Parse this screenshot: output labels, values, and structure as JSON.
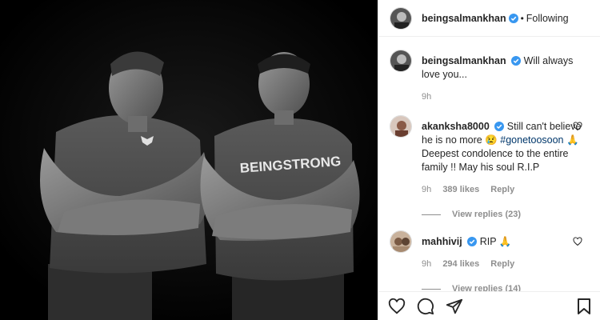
{
  "post": {
    "username": "beingsalmankhan",
    "following_label": "Following",
    "dot": "•"
  },
  "caption": {
    "username": "beingsalmankhan",
    "text": "Will always love you...",
    "time": "9h"
  },
  "photo": {
    "shirt_text": "BEINGSTRONG"
  },
  "comments": [
    {
      "username": "akanksha8000",
      "text_before": "Still can't believe he is no more 😢",
      "hashtag": "#gonetoosoon",
      "text_after": "🙏 Deepest condolence to the entire family !! May his soul R.I.P",
      "time": "9h",
      "likes": "389 likes",
      "reply": "Reply",
      "view_replies": "View replies (23)"
    },
    {
      "username": "mahhivij",
      "text_before": "RIP 🙏",
      "hashtag": "",
      "text_after": "",
      "time": "9h",
      "likes": "294 likes",
      "reply": "Reply",
      "view_replies": "View replies (14)"
    }
  ],
  "icons": {
    "verified": "verified-badge-icon",
    "heart": "heart-icon",
    "comment": "comment-icon",
    "share": "share-icon",
    "save": "bookmark-icon"
  },
  "colors": {
    "verified": "#3897f0",
    "muted": "#8e8e8e",
    "hashtag": "#00376b"
  }
}
